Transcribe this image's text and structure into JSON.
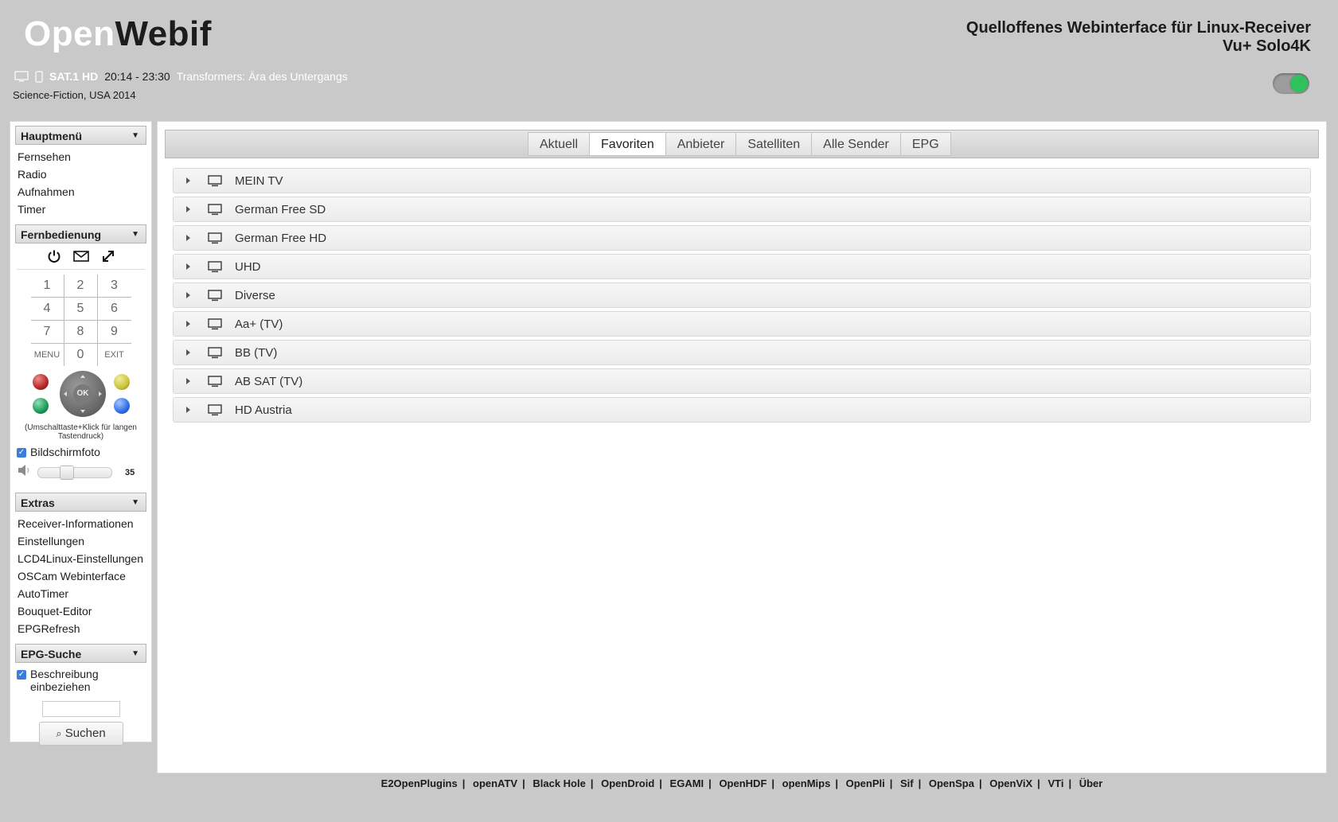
{
  "header": {
    "logo_part1": "Open",
    "logo_part2": "Webif",
    "tagline_line1": "Quelloffenes Webinterface für Linux-Receiver",
    "tagline_line2": "Vu+ Solo4K"
  },
  "now_playing": {
    "channel": "SAT.1 HD",
    "time": "20:14 - 23:30",
    "event": "Transformers: Ära des Untergangs",
    "genre": "Science-Fiction, USA 2014"
  },
  "theme_toggle": {
    "on": true,
    "knob_color": "#2fc15b"
  },
  "sidebar": {
    "main_menu": {
      "title": "Hauptmenü",
      "items": [
        "Fernsehen",
        "Radio",
        "Aufnahmen",
        "Timer"
      ]
    },
    "remote": {
      "title": "Fernbedienung",
      "icons": [
        "power-icon",
        "message-icon",
        "fullscreen-icon"
      ],
      "keys": [
        "1",
        "2",
        "3",
        "4",
        "5",
        "6",
        "7",
        "8",
        "9",
        "MENU",
        "0",
        "EXIT"
      ],
      "ok_label": "OK",
      "color_buttons": [
        "#b52727",
        "#c9c33a",
        "#1c9a57",
        "#2f6fe8"
      ],
      "hint": "(Umschalttaste+Klick für langen Tastendruck)",
      "screenshot_label": "Bildschirmfoto",
      "volume": 35
    },
    "extras": {
      "title": "Extras",
      "items": [
        "Receiver-Informationen",
        "Einstellungen",
        "LCD4Linux-Einstellungen",
        "OSCam Webinterface",
        "AutoTimer",
        "Bouquet-Editor",
        "EPGRefresh"
      ]
    },
    "epg_search": {
      "title": "EPG-Suche",
      "include_desc_label": "Beschreibung einbeziehen",
      "search_value": "",
      "search_button": "Suchen"
    }
  },
  "main": {
    "tabs": [
      {
        "label": "Aktuell",
        "active": false
      },
      {
        "label": "Favoriten",
        "active": true
      },
      {
        "label": "Anbieter",
        "active": false
      },
      {
        "label": "Satelliten",
        "active": false
      },
      {
        "label": "Alle Sender",
        "active": false
      },
      {
        "label": "EPG",
        "active": false
      }
    ],
    "bouquets": [
      "MEIN TV",
      "German Free SD",
      "German Free HD",
      "UHD",
      "Diverse",
      "Aa+ (TV)",
      "BB (TV)",
      "AB SAT (TV)",
      "HD Austria"
    ]
  },
  "footer": {
    "links": [
      "E2OpenPlugins",
      "openATV",
      "Black Hole",
      "OpenDroid",
      "EGAMI",
      "OpenHDF",
      "openMips",
      "OpenPli",
      "Sif",
      "OpenSpa",
      "OpenViX",
      "VTi",
      "Über"
    ]
  }
}
